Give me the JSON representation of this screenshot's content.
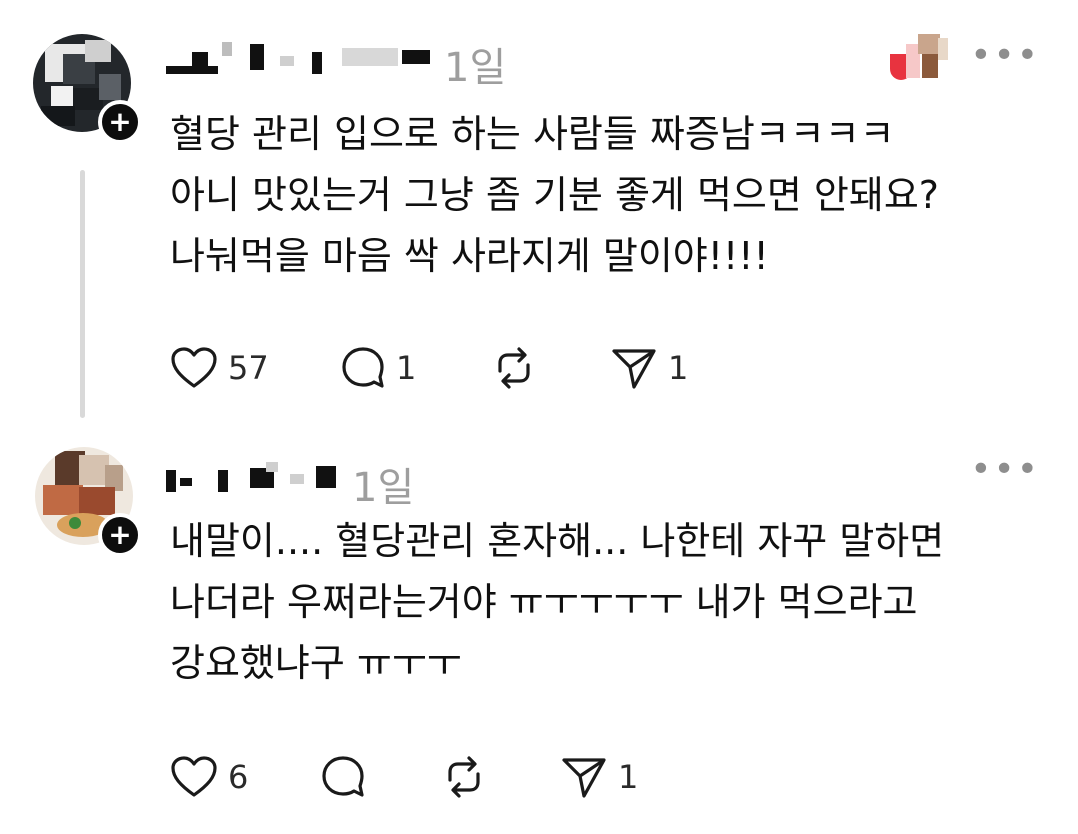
{
  "posts": [
    {
      "time": "1일",
      "text": "혈당 관리 입으로 하는 사람들 짜증남ㅋㅋㅋㅋ\n아니 맛있는거 그냥 좀 기분 좋게 먹으면 안돼요?\n나눠먹을 마음 싹 사라지게 말이야!!!!",
      "likes": "57",
      "replies": "1",
      "reposts": "",
      "shares": "1",
      "more_label": "•••",
      "plus_label": "+"
    },
    {
      "time": "1일",
      "text": "내말이.... 혈당관리 혼자해... 나한테 자꾸 말하면\n나더라 우쩌라는거야 ㅠㅜㅜㅜㅜ 내가 먹으라고\n강요했냐구 ㅠㅜㅜ",
      "likes": "6",
      "replies": "",
      "reposts": "",
      "shares": "1",
      "more_label": "•••",
      "plus_label": "+"
    }
  ],
  "icons": {
    "like": "heart-icon",
    "reply": "comment-icon",
    "repost": "repost-icon",
    "share": "send-icon",
    "more": "more-icon",
    "follow": "plus-icon"
  },
  "colors": {
    "text": "#101010",
    "muted": "#9e9e9e",
    "thread_line": "#d9d9d9",
    "badge_red": "#e8333f"
  }
}
